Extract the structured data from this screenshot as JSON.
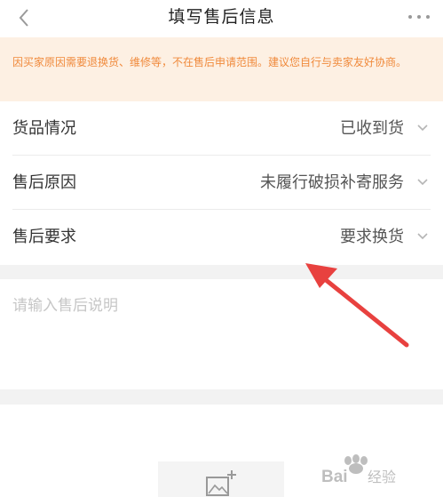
{
  "header": {
    "title": "填写售后信息",
    "back_icon": "chevron-left-icon",
    "more_icon": "more-horizontal-icon"
  },
  "notice": {
    "text": "因买家原因需要退换货、维修等，不在售后申请范围。建议您自行与卖家友好协商。"
  },
  "form": {
    "rows": [
      {
        "label": "货品情况",
        "value": "已收到货"
      },
      {
        "label": "售后原因",
        "value": "未履行破损补寄服务"
      },
      {
        "label": "售后要求",
        "value": "要求换货"
      }
    ]
  },
  "description": {
    "placeholder": "请输入售后说明",
    "value": ""
  },
  "upload": {
    "icon": "add-image-icon"
  },
  "watermark": {
    "text": "Baidu经验"
  },
  "colors": {
    "notice_background": "#fdf0e3",
    "notice_text": "#f08a3c",
    "annotation_arrow": "#e8413f",
    "page_background": "#f2f2f2"
  }
}
